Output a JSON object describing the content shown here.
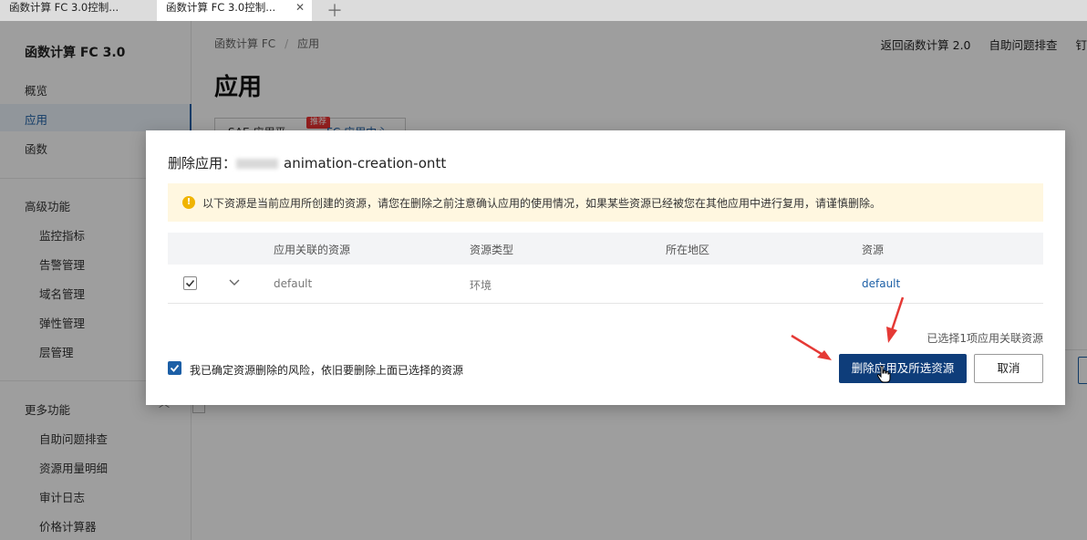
{
  "browser": {
    "tabs": [
      {
        "label": "函数计算 FC 3.0控制..."
      },
      {
        "label": "函数计算 FC 3.0控制..."
      }
    ]
  },
  "sidebar": {
    "title": "函数计算 FC 3.0",
    "items": [
      "概览",
      "应用",
      "函数"
    ],
    "advanced_section": "高级功能",
    "advanced_items": [
      "监控指标",
      "告警管理",
      "域名管理",
      "弹性管理",
      "层管理"
    ],
    "more_section": "更多功能",
    "more_items": [
      "自助问题排查",
      "资源用量明细",
      "审计日志",
      "价格计算器"
    ]
  },
  "header": {
    "breadcrumb": [
      "函数计算 FC",
      "应用"
    ],
    "links": [
      "返回函数计算 2.0",
      "自助问题排查",
      "钉"
    ],
    "page_title": "应用",
    "tabs": [
      "SAE 应用平",
      "FC 应用中心"
    ],
    "tab_badge": "推荐"
  },
  "modal": {
    "title_prefix": "删除应用：",
    "app_name_visible": "animation-creation-ontt",
    "notice": "以下资源是当前应用所创建的资源，请您在删除之前注意确认应用的使用情况，如果某些资源已经被您在其他应用中进行复用，请谨慎删除。",
    "table": {
      "columns": [
        "应用关联的资源",
        "资源类型",
        "所在地区",
        "资源"
      ],
      "rows": [
        {
          "name": "default",
          "type": "环境",
          "region": "",
          "resource": "default",
          "checked": true
        }
      ]
    },
    "selected_info": "已选择1项应用关联资源",
    "confirm_checkbox_label": "我已确定资源删除的风险，依旧要删除上面已选择的资源",
    "confirm_checked": true,
    "primary_button": "删除应用及所选资源",
    "cancel_button": "取消"
  },
  "colors": {
    "primary": "#0e3d7a",
    "link": "#1c5fa6",
    "warning_bg": "#fff7e0",
    "warning_icon": "#f0b400",
    "annotation_arrow": "#e53935"
  }
}
